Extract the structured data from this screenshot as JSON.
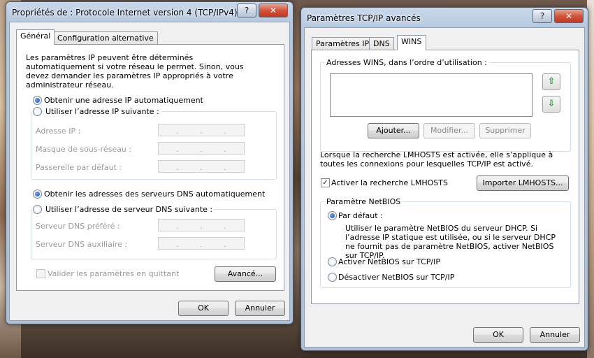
{
  "left_dialog": {
    "title": "Propriétés de : Protocole Internet version 4 (TCP/IPv4)",
    "help": "?",
    "close": "✕",
    "tabs": [
      "Général",
      "Configuration alternative"
    ],
    "intro": "Les paramètres IP peuvent être déterminés automatiquement si votre réseau le permet. Sinon, vous devez demander les paramètres IP appropriés à votre administrateur réseau.",
    "radio_auto_ip": "Obtenir une adresse IP automatiquement",
    "radio_manual_ip": "Utiliser l’adresse IP suivante :",
    "ip_label": "Adresse IP :",
    "mask_label": "Masque de sous-réseau :",
    "gateway_label": "Passerelle par défaut :",
    "radio_auto_dns": "Obtenir les adresses des serveurs DNS automatiquement",
    "radio_manual_dns": "Utiliser l’adresse de serveur DNS suivante :",
    "dns_pref_label": "Serveur DNS préféré :",
    "dns_alt_label": "Serveur DNS auxiliaire :",
    "validate_label": "Valider les paramètres en quittant",
    "advanced_btn": "Avancé...",
    "ok_btn": "OK",
    "cancel_btn": "Annuler",
    "dot": "."
  },
  "right_dialog": {
    "title": "Paramètres TCP/IP avancés",
    "help": "?",
    "close": "✕",
    "tabs": [
      "Paramètres IP",
      "DNS",
      "WINS"
    ],
    "wins_group_label": "Adresses WINS, dans l’ordre d’utilisation :",
    "add_btn": "Ajouter...",
    "edit_btn": "Modifier...",
    "remove_btn": "Supprimer",
    "up_arrow": "⇧",
    "down_arrow": "⇩",
    "lmhosts_text": "Lorsque la recherche LMHOSTS est activée, elle s’applique à toutes les connexions pour lesquelles TCP/IP est activé.",
    "lmhosts_check": "Activer la recherche LMHOSTS",
    "check_mark": "✓",
    "import_btn": "Importer LMHOSTS...",
    "netbios_group": "Paramètre NetBIOS",
    "netbios_default": "Par défaut :",
    "netbios_default_desc": "Utiliser le paramètre NetBIOS du serveur DHCP. Si l’adresse IP statique est utilisée, ou si le serveur DHCP ne fournit pas de paramètre NetBIOS, activer NetBIOS sur TCP/IP.",
    "netbios_enable": "Activer NetBIOS sur TCP/IP",
    "netbios_disable": "Désactiver NetBIOS sur TCP/IP",
    "ok_btn": "OK",
    "cancel_btn": "Annuler"
  }
}
